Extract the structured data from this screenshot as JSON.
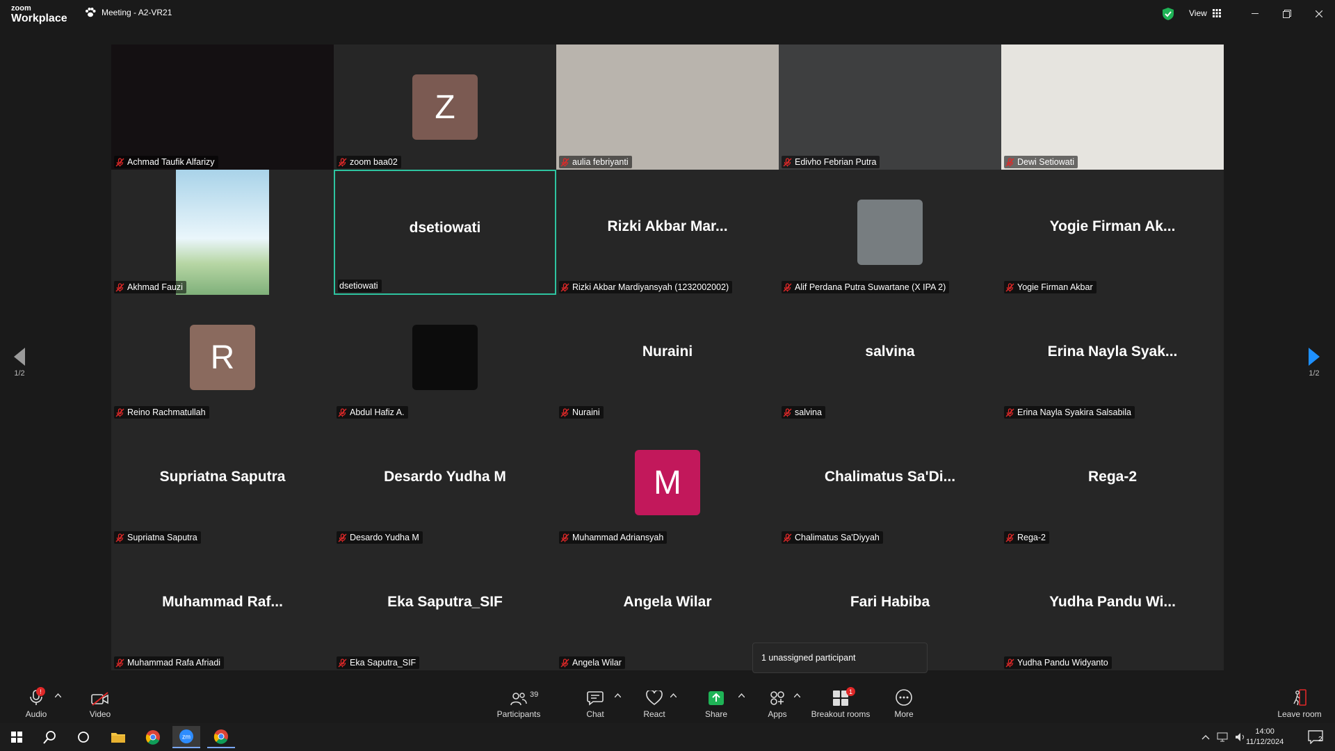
{
  "titlebar": {
    "logo_line1": "zoom",
    "logo_line2": "Workplace",
    "meeting_title": "Meeting - A2-VR21",
    "view_label": "View"
  },
  "pager": {
    "left": "1/2",
    "right": "1/2"
  },
  "tiles": [
    {
      "name": "Achmad Taufik Alfarizy",
      "type": "video",
      "bg": "#141012"
    },
    {
      "name": "zoom baa02",
      "type": "avatar",
      "letter": "Z",
      "color": "#7b5a52"
    },
    {
      "name": "aulia febriyanti",
      "type": "video",
      "bg": "#b9b4ad"
    },
    {
      "name": "Edivho Febrian Putra",
      "type": "video",
      "bg": "#3e3f40"
    },
    {
      "name": "Dewi Setiowati",
      "type": "video",
      "bg": "#e6e4df"
    },
    {
      "name": "Akhmad Fauzi",
      "type": "image",
      "bg": "#a9d3e9"
    },
    {
      "name": "dsetiowati",
      "display": "dsetiowati",
      "type": "text",
      "active": true
    },
    {
      "name": "Rizki Akbar Mardiyansyah (1232002002)",
      "display": "Rizki Akbar Mar...",
      "type": "text"
    },
    {
      "name": "Alif Perdana Putra Suwartane (X IPA 2)",
      "type": "photo",
      "color": "#777d80"
    },
    {
      "name": "Yogie Firman Akbar",
      "display": "Yogie Firman Ak...",
      "type": "text"
    },
    {
      "name": "Reino Rachmatullah",
      "type": "avatar",
      "letter": "R",
      "color": "#8a6a5e"
    },
    {
      "name": "Abdul Hafiz A.",
      "type": "photo",
      "color": "#0c0c0c"
    },
    {
      "name": "Nuraini",
      "display": "Nuraini",
      "type": "text"
    },
    {
      "name": "salvina",
      "display": "salvina",
      "type": "text"
    },
    {
      "name": "Erina Nayla Syakira Salsabila",
      "display": "Erina Nayla Syak...",
      "type": "text"
    },
    {
      "name": "Supriatna Saputra",
      "display": "Supriatna Saputra",
      "type": "text"
    },
    {
      "name": "Desardo Yudha M",
      "display": "Desardo Yudha M",
      "type": "text"
    },
    {
      "name": "Muhammad Adriansyah",
      "type": "avatar",
      "letter": "M",
      "color": "#c2185b"
    },
    {
      "name": "Chalimatus Sa'Diyyah",
      "display": "Chalimatus  Sa'Di...",
      "type": "text"
    },
    {
      "name": "Rega-2",
      "display": "Rega-2",
      "type": "text"
    },
    {
      "name": "Muhammad Rafa Afriadi",
      "display": "Muhammad  Raf...",
      "type": "text"
    },
    {
      "name": "Eka Saputra_SIF",
      "display": "Eka Saputra_SIF",
      "type": "text"
    },
    {
      "name": "Angela Wilar",
      "display": "Angela Wilar",
      "type": "text"
    },
    {
      "name": "Fari Habiba",
      "display": "Fari Habiba",
      "type": "text",
      "hide_label": true
    },
    {
      "name": "Yudha Pandu Widyanto",
      "display": "Yudha Pandu Wi...",
      "type": "text"
    }
  ],
  "popup": {
    "text": "1 unassigned participant"
  },
  "toolbar": {
    "audio": "Audio",
    "video": "Video",
    "participants": "Participants",
    "participants_count": "39",
    "chat": "Chat",
    "react": "React",
    "share": "Share",
    "apps": "Apps",
    "breakout": "Breakout rooms",
    "breakout_badge": "1",
    "more": "More",
    "leave": "Leave room"
  },
  "taskbar": {
    "time": "14:00",
    "date": "11/12/2024",
    "notif_count": "2"
  },
  "colors": {
    "active_border": "#2ec4a0",
    "share_green": "#1fb356",
    "muted_red": "#e02828",
    "pager_blue": "#1e90ff"
  }
}
